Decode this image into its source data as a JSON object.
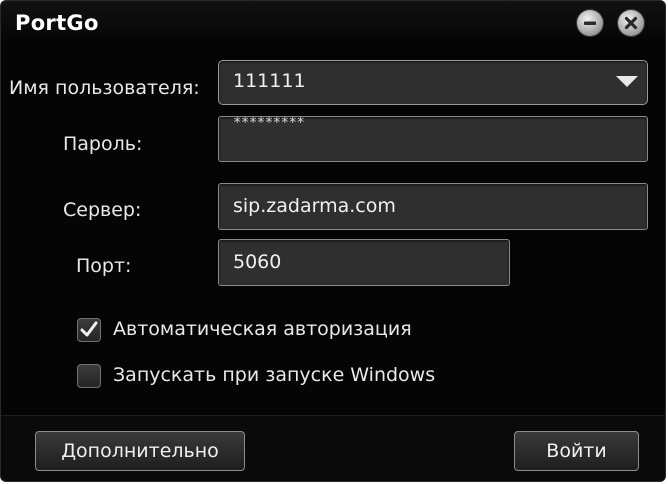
{
  "window": {
    "title": "PortGo"
  },
  "form": {
    "username_label": "Имя пользователя:",
    "username_value": "111111",
    "password_label": "Пароль:",
    "password_mask": "*********",
    "server_label": "Сервер:",
    "server_value": "sip.zadarma.com",
    "port_label": "Порт:",
    "port_value": "5060"
  },
  "options": {
    "auto_login_label": "Автоматическая авторизация",
    "auto_login_checked": true,
    "start_with_windows_label": "Запускать при запуске Windows",
    "start_with_windows_checked": false
  },
  "buttons": {
    "advanced_label": "Дополнительно",
    "login_label": "Войти"
  },
  "icons": {
    "minimize": "minimize-icon",
    "close": "close-icon",
    "dropdown": "chevron-down-icon",
    "check": "checkmark-icon"
  }
}
